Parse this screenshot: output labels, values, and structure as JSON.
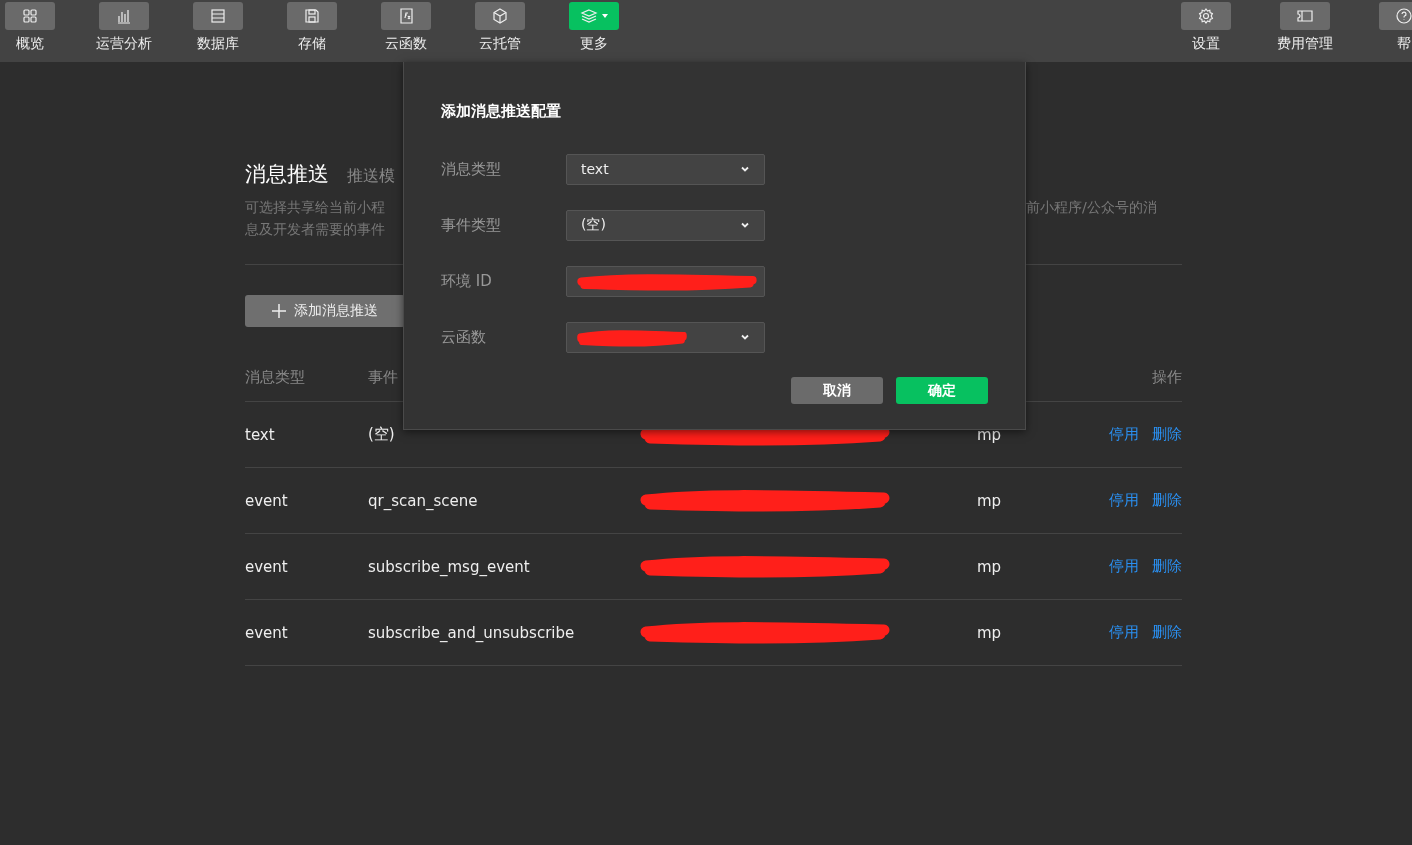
{
  "toolbar": {
    "left": [
      {
        "label": "概览",
        "kind": "plain"
      },
      {
        "label": "运营分析",
        "kind": "plain"
      },
      {
        "label": "数据库",
        "kind": "plain"
      },
      {
        "label": "存储",
        "kind": "plain"
      },
      {
        "label": "云函数",
        "kind": "plain"
      },
      {
        "label": "云托管",
        "kind": "plain"
      },
      {
        "label": "更多",
        "kind": "dropdown"
      }
    ],
    "right": [
      {
        "label": "设置"
      },
      {
        "label": "费用管理"
      },
      {
        "label": "帮"
      }
    ]
  },
  "page": {
    "title": "消息推送",
    "subtitle": "推送模",
    "description_left": [
      "可选择共享给当前小程",
      "息及开发者需要的事件"
    ],
    "description_right": "前小程序/公众号的消",
    "add_button": "添加消息推送"
  },
  "table": {
    "columns": [
      "消息类型",
      "事件",
      "操作"
    ],
    "rows": [
      {
        "msg_type": "text",
        "event": "(空)",
        "env_redacted": true,
        "source": "mp",
        "actions": [
          "停用",
          "删除"
        ]
      },
      {
        "msg_type": "event",
        "event": "qr_scan_scene",
        "env_redacted": true,
        "source": "mp",
        "actions": [
          "停用",
          "删除"
        ]
      },
      {
        "msg_type": "event",
        "event": "subscribe_msg_event",
        "env_redacted": true,
        "source": "mp",
        "actions": [
          "停用",
          "删除"
        ]
      },
      {
        "msg_type": "event",
        "event": "subscribe_and_unsubscribe",
        "env_redacted": true,
        "source": "mp",
        "actions": [
          "停用",
          "删除"
        ]
      }
    ]
  },
  "dialog": {
    "title": "添加消息推送配置",
    "fields": [
      {
        "label": "消息类型",
        "kind": "select",
        "value": "text",
        "redacted": false
      },
      {
        "label": "事件类型",
        "kind": "select",
        "value": "(空)",
        "redacted": false
      },
      {
        "label": "环境 ID",
        "kind": "input",
        "redacted": true
      },
      {
        "label": "云函数",
        "kind": "select",
        "redacted": true
      }
    ],
    "buttons": [
      {
        "label": "取消",
        "kind": "secondary"
      },
      {
        "label": "确定",
        "kind": "primary"
      }
    ]
  }
}
